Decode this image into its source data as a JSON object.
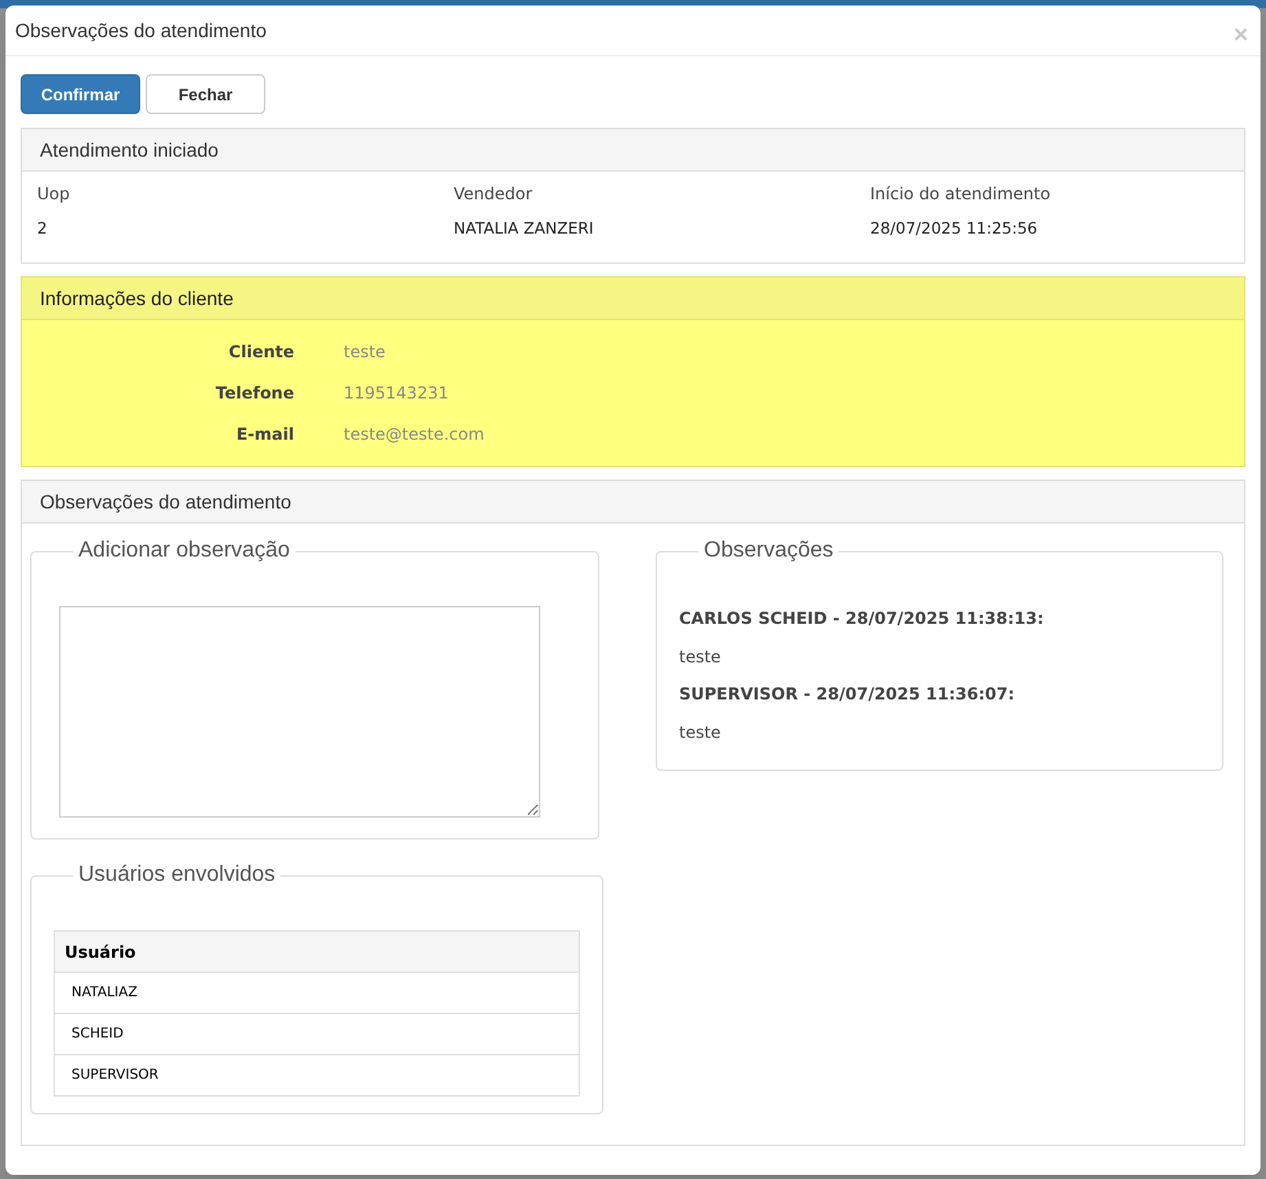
{
  "dialog": {
    "title": "Observações do atendimento",
    "close": "×"
  },
  "buttons": [
    {
      "label": "Confirmar",
      "kind": "primary"
    },
    {
      "label": "Fechar",
      "kind": "default"
    }
  ],
  "attendance": {
    "title": "Atendimento iniciado",
    "columns": [
      "Uop",
      "Vendedor",
      "Início do atendimento"
    ],
    "values": [
      "2",
      "NATALIA ZANZERI",
      "28/07/2025 11:25:56"
    ]
  },
  "client": {
    "title": "Informações do cliente",
    "fields": [
      {
        "label": "Cliente",
        "value": "teste"
      },
      {
        "label": "Telefone",
        "value": "1195143231"
      },
      {
        "label": "E-mail",
        "value": "teste@teste.com"
      }
    ]
  },
  "observations_panel": {
    "title": "Observações do atendimento",
    "add": {
      "legend": "Adicionar observação"
    },
    "list": {
      "legend": "Observações",
      "entries": [
        {
          "header": "CARLOS SCHEID - 28/07/2025 11:38:13:",
          "text": "teste"
        },
        {
          "header": "SUPERVISOR - 28/07/2025 11:36:07:",
          "text": "teste"
        }
      ]
    },
    "users": {
      "legend": "Usuários envolvidos",
      "column": "Usuário",
      "rows": [
        "NATALIAZ",
        "SCHEID",
        "SUPERVISOR"
      ]
    }
  }
}
